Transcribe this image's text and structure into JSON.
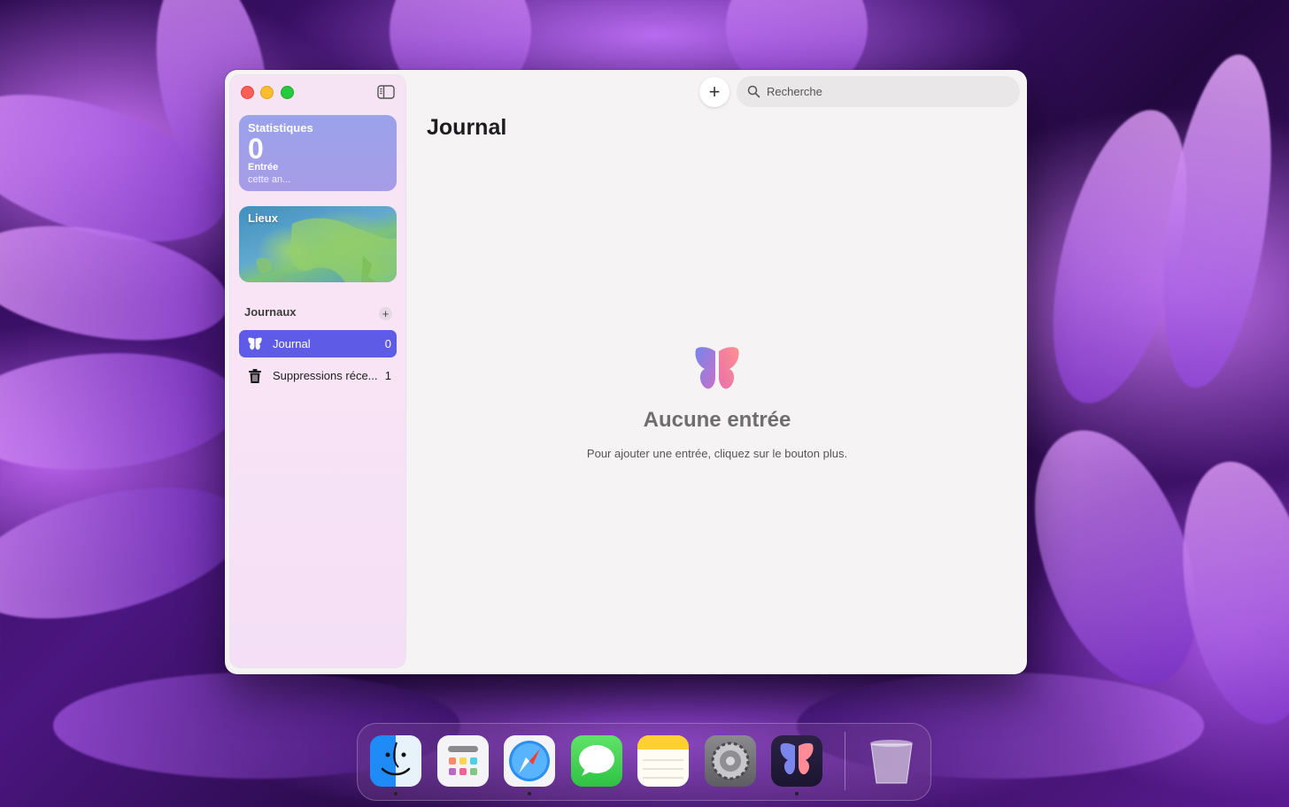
{
  "window": {
    "title": "Journal"
  },
  "sidebar": {
    "stats": {
      "title": "Statistiques",
      "value": "0",
      "label": "Entrée",
      "sublabel": "cette an..."
    },
    "places": {
      "title": "Lieux"
    },
    "journals_section": {
      "title": "Journaux",
      "add_label": "+"
    },
    "items": [
      {
        "label": "Journal",
        "count": "0",
        "icon": "butterfly-icon",
        "selected": true
      },
      {
        "label": "Suppressions réce...",
        "count": "1",
        "icon": "trash-icon",
        "selected": false
      }
    ]
  },
  "toolbar": {
    "add_label": "+",
    "search_placeholder": "Recherche"
  },
  "main": {
    "title": "Journal",
    "empty_title": "Aucune entrée",
    "empty_subtitle": "Pour ajouter une entrée, cliquez sur le bouton plus."
  },
  "dock": {
    "items": [
      {
        "name": "finder",
        "icon": "finder-icon",
        "running": true
      },
      {
        "name": "launchpad",
        "icon": "launchpad-icon",
        "running": false
      },
      {
        "name": "safari",
        "icon": "safari-icon",
        "running": true
      },
      {
        "name": "messages",
        "icon": "messages-icon",
        "running": false
      },
      {
        "name": "notes",
        "icon": "notes-icon",
        "running": false
      },
      {
        "name": "settings",
        "icon": "settings-icon",
        "running": false
      },
      {
        "name": "journal",
        "icon": "journal-app-icon",
        "running": true
      },
      {
        "name": "trash",
        "icon": "trash-icon",
        "running": false
      }
    ]
  },
  "colors": {
    "accent": "#5e5ce6",
    "stats_card": "#9aa3eb",
    "close": "#ff5f57",
    "minimize": "#febc2e",
    "zoom": "#28c840"
  }
}
